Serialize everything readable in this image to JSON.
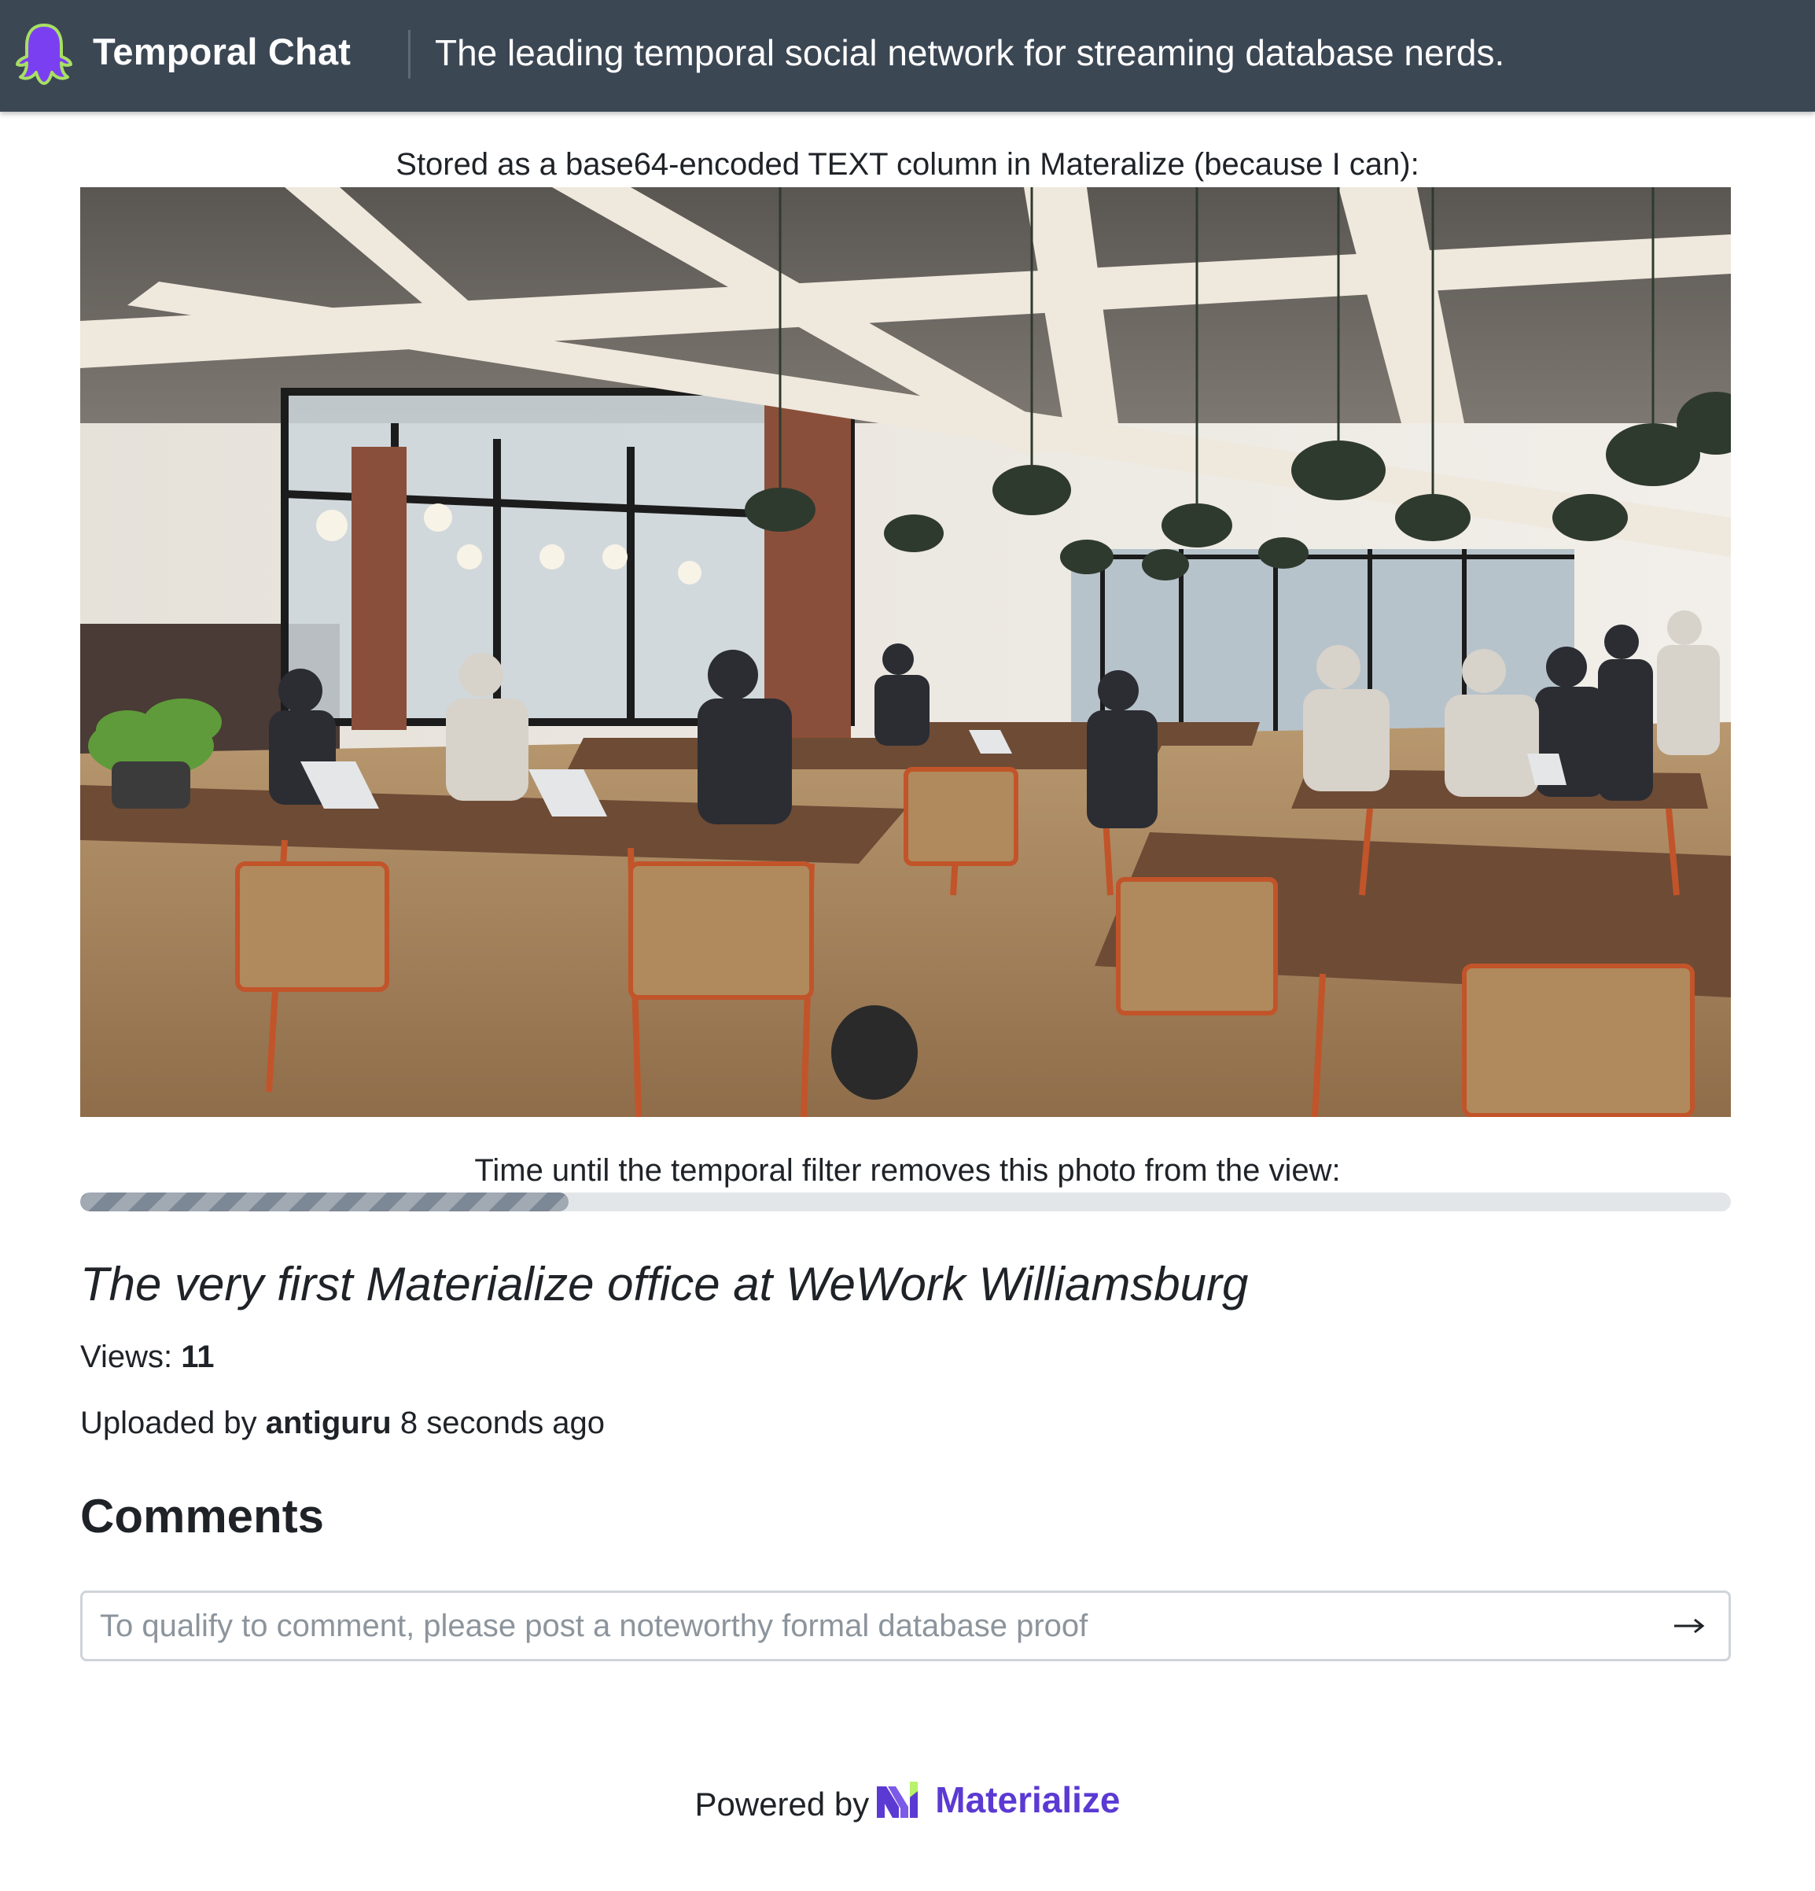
{
  "header": {
    "app_name": "Temporal Chat",
    "tagline": "The leading temporal social network for streaming database nerds.",
    "logo_icon": "ghost-icon",
    "background": "#3c4754",
    "logo_color": "#7b3ff2"
  },
  "photo": {
    "caption": "Stored as a base64-encoded TEXT column in Materalize (because I can):",
    "subject": "office-coworking-space-photo"
  },
  "timer": {
    "label": "Time until the temporal filter removes this photo from the view:",
    "remaining_fraction": 0.296,
    "fill_color": "#7d8896",
    "track_color": "#e3e6e9"
  },
  "post": {
    "title": "The very first Materialize office at WeWork Williamsburg",
    "views_label": "Views:",
    "views_count": "11",
    "uploaded_prefix": "Uploaded by",
    "uploader": "antiguru",
    "uploaded_time": "8 seconds ago"
  },
  "comments": {
    "heading": "Comments",
    "placeholder": "To qualify to comment, please post a noteworthy formal database proof",
    "value": "",
    "submit_icon": "arrow-right-icon"
  },
  "footer": {
    "powered_by": "Powered by",
    "brand": "Materialize",
    "brand_color": "#5b3ad3"
  }
}
